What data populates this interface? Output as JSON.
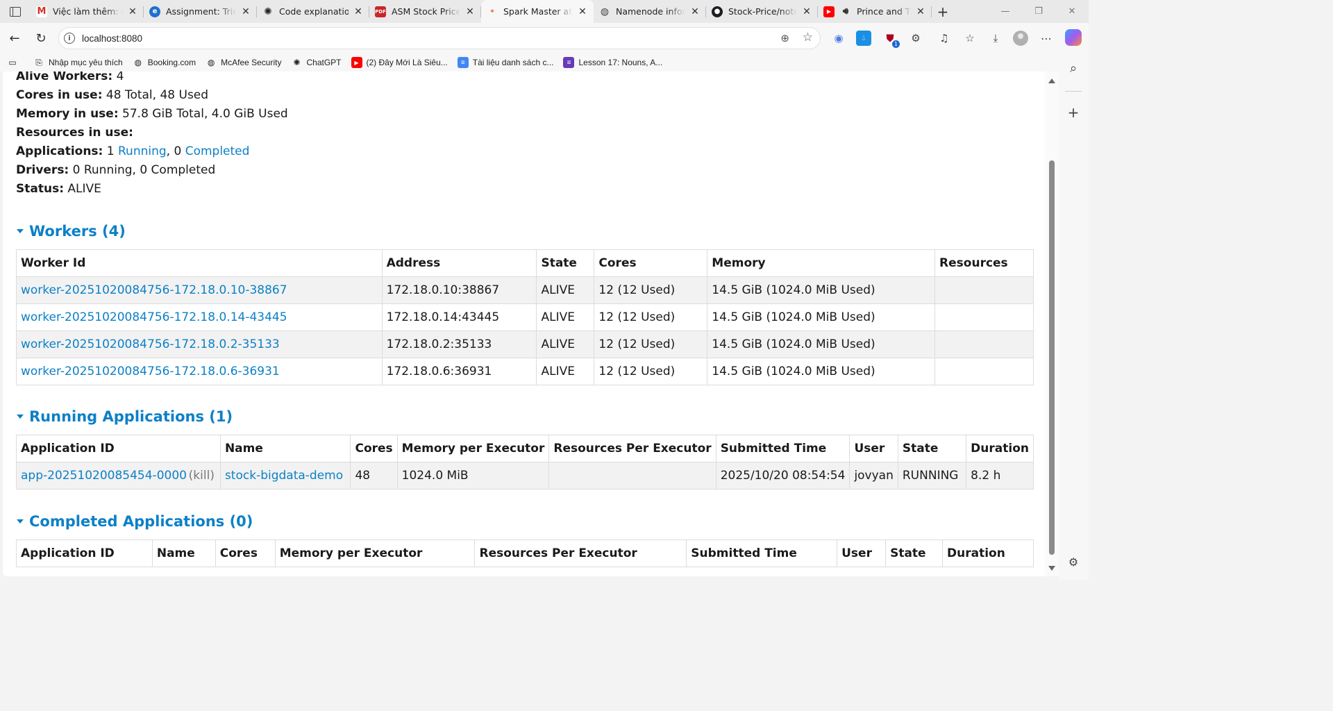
{
  "browser": {
    "tabs": [
      {
        "title": "Việc làm thêm: Cố",
        "icon": "gmail-icon",
        "active": false
      },
      {
        "title": "Assignment: Triển",
        "icon": "edge-icon",
        "active": false
      },
      {
        "title": "Code explanation",
        "icon": "chatgpt-icon",
        "active": false
      },
      {
        "title": "ASM Stock Price B",
        "icon": "pdf-icon",
        "active": false
      },
      {
        "title": "Spark Master at sp",
        "icon": "spark-icon",
        "active": true
      },
      {
        "title": "Namenode inform",
        "icon": "globe-icon",
        "active": false
      },
      {
        "title": "Stock-Price/noteb",
        "icon": "github-icon",
        "active": false
      },
      {
        "title": "Prince and Th",
        "icon": "youtube-icon",
        "active": false
      }
    ],
    "url": "localhost:8080",
    "extension_badge": "1",
    "bookmarks": [
      {
        "label": "Nhập mục yêu thích",
        "icon": "import-favorites-icon"
      },
      {
        "label": "Booking.com",
        "icon": "globe-icon"
      },
      {
        "label": "McAfee Security",
        "icon": "globe-icon"
      },
      {
        "label": "ChatGPT",
        "icon": "chatgpt-icon"
      },
      {
        "label": "(2) Đây Mới Là Siêu...",
        "icon": "youtube-icon"
      },
      {
        "label": "Tài liệu danh sách c...",
        "icon": "google-docs-icon"
      },
      {
        "label": "Lesson 17: Nouns, A...",
        "icon": "google-forms-icon"
      }
    ]
  },
  "summary": {
    "alive_workers_label": "Alive Workers:",
    "alive_workers_value": "4",
    "cores_label": "Cores in use:",
    "cores_value": "48 Total, 48 Used",
    "memory_label": "Memory in use:",
    "memory_value": "57.8 GiB Total, 4.0 GiB Used",
    "resources_label": "Resources in use:",
    "applications_label": "Applications:",
    "applications_running_count": "1",
    "applications_running_link": "Running",
    "applications_sep": ", 0",
    "applications_completed_link": "Completed",
    "drivers_label": "Drivers:",
    "drivers_value": "0 Running, 0 Completed",
    "status_label": "Status:",
    "status_value": "ALIVE"
  },
  "workers": {
    "title": "Workers (4)",
    "columns": [
      "Worker Id",
      "Address",
      "State",
      "Cores",
      "Memory",
      "Resources"
    ],
    "rows": [
      {
        "id": "worker-20251020084756-172.18.0.10-38867",
        "address": "172.18.0.10:38867",
        "state": "ALIVE",
        "cores": "12 (12 Used)",
        "memory": "14.5 GiB (1024.0 MiB Used)",
        "resources": ""
      },
      {
        "id": "worker-20251020084756-172.18.0.14-43445",
        "address": "172.18.0.14:43445",
        "state": "ALIVE",
        "cores": "12 (12 Used)",
        "memory": "14.5 GiB (1024.0 MiB Used)",
        "resources": ""
      },
      {
        "id": "worker-20251020084756-172.18.0.2-35133",
        "address": "172.18.0.2:35133",
        "state": "ALIVE",
        "cores": "12 (12 Used)",
        "memory": "14.5 GiB (1024.0 MiB Used)",
        "resources": ""
      },
      {
        "id": "worker-20251020084756-172.18.0.6-36931",
        "address": "172.18.0.6:36931",
        "state": "ALIVE",
        "cores": "12 (12 Used)",
        "memory": "14.5 GiB (1024.0 MiB Used)",
        "resources": ""
      }
    ]
  },
  "running_apps": {
    "title": "Running Applications (1)",
    "columns": [
      "Application ID",
      "Name",
      "Cores",
      "Memory per Executor",
      "Resources Per Executor",
      "Submitted Time",
      "User",
      "State",
      "Duration"
    ],
    "rows": [
      {
        "id": "app-20251020085454-0000",
        "kill": "(kill)",
        "name": "stock-bigdata-demo",
        "cores": "48",
        "memory": "1024.0 MiB",
        "resources": "",
        "submitted": "2025/10/20 08:54:54",
        "user": "jovyan",
        "state": "RUNNING",
        "duration": "8.2 h"
      }
    ]
  },
  "completed_apps": {
    "title": "Completed Applications (0)",
    "columns": [
      "Application ID",
      "Name",
      "Cores",
      "Memory per Executor",
      "Resources Per Executor",
      "Submitted Time",
      "User",
      "State",
      "Duration"
    ]
  },
  "colors": {
    "link": "#0c80c7",
    "row_alt": "#f2f2f2"
  }
}
